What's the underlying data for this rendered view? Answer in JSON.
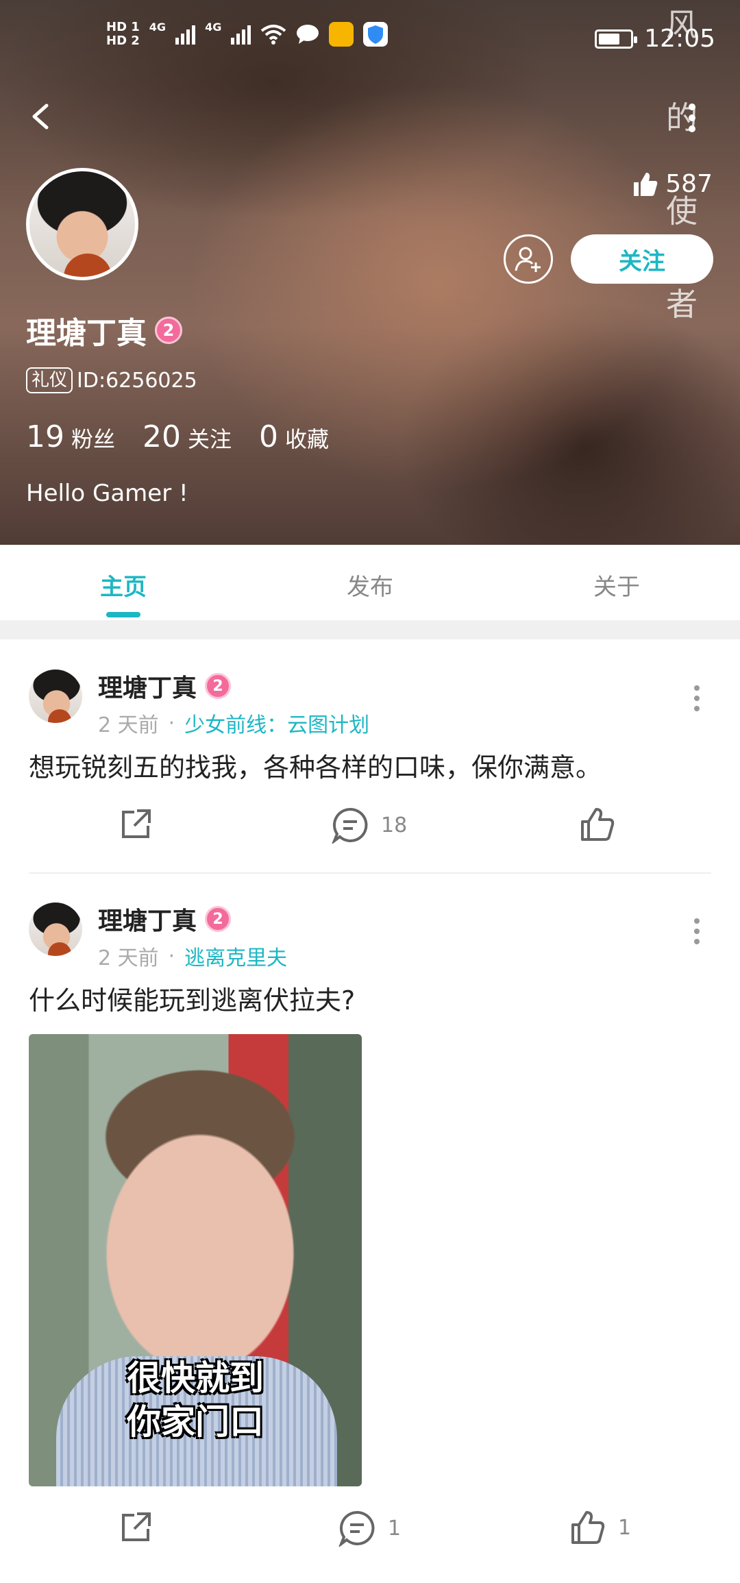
{
  "status_bar": {
    "sim1": "HD 1",
    "sim2": "HD 2",
    "net1": "4G",
    "net2": "4G",
    "time": "12:05"
  },
  "header": {
    "side_text": [
      "风",
      "的",
      "使",
      "者"
    ],
    "likes": "587",
    "follow_label": "关注"
  },
  "profile": {
    "name": "理塘丁真",
    "level": "2",
    "tag": "礼仪",
    "id": "ID:6256025",
    "followers_count": "19",
    "followers_label": "粉丝",
    "following_count": "20",
    "following_label": "关注",
    "favorites_count": "0",
    "favorites_label": "收藏",
    "bio": "Hello Gamer !"
  },
  "tabs": [
    {
      "label": "主页",
      "active": true
    },
    {
      "label": "发布",
      "active": false
    },
    {
      "label": "关于",
      "active": false
    }
  ],
  "posts": [
    {
      "author": "理塘丁真",
      "level": "2",
      "time": "2 天前",
      "game": "少女前线：云图计划",
      "text": "想玩锐刻五的找我，各种各样的口味，保你满意。",
      "comments": "18",
      "likes": ""
    },
    {
      "author": "理塘丁真",
      "level": "2",
      "time": "2 天前",
      "game": "逃离克里夫",
      "text": "什么时候能玩到逃离伏拉夫?",
      "image_caption_1": "很快就到",
      "image_caption_2": "你家门口",
      "comments": "1",
      "likes": "1"
    }
  ],
  "colors": {
    "accent": "#1db7c4",
    "level_badge": "#f26b9b"
  }
}
